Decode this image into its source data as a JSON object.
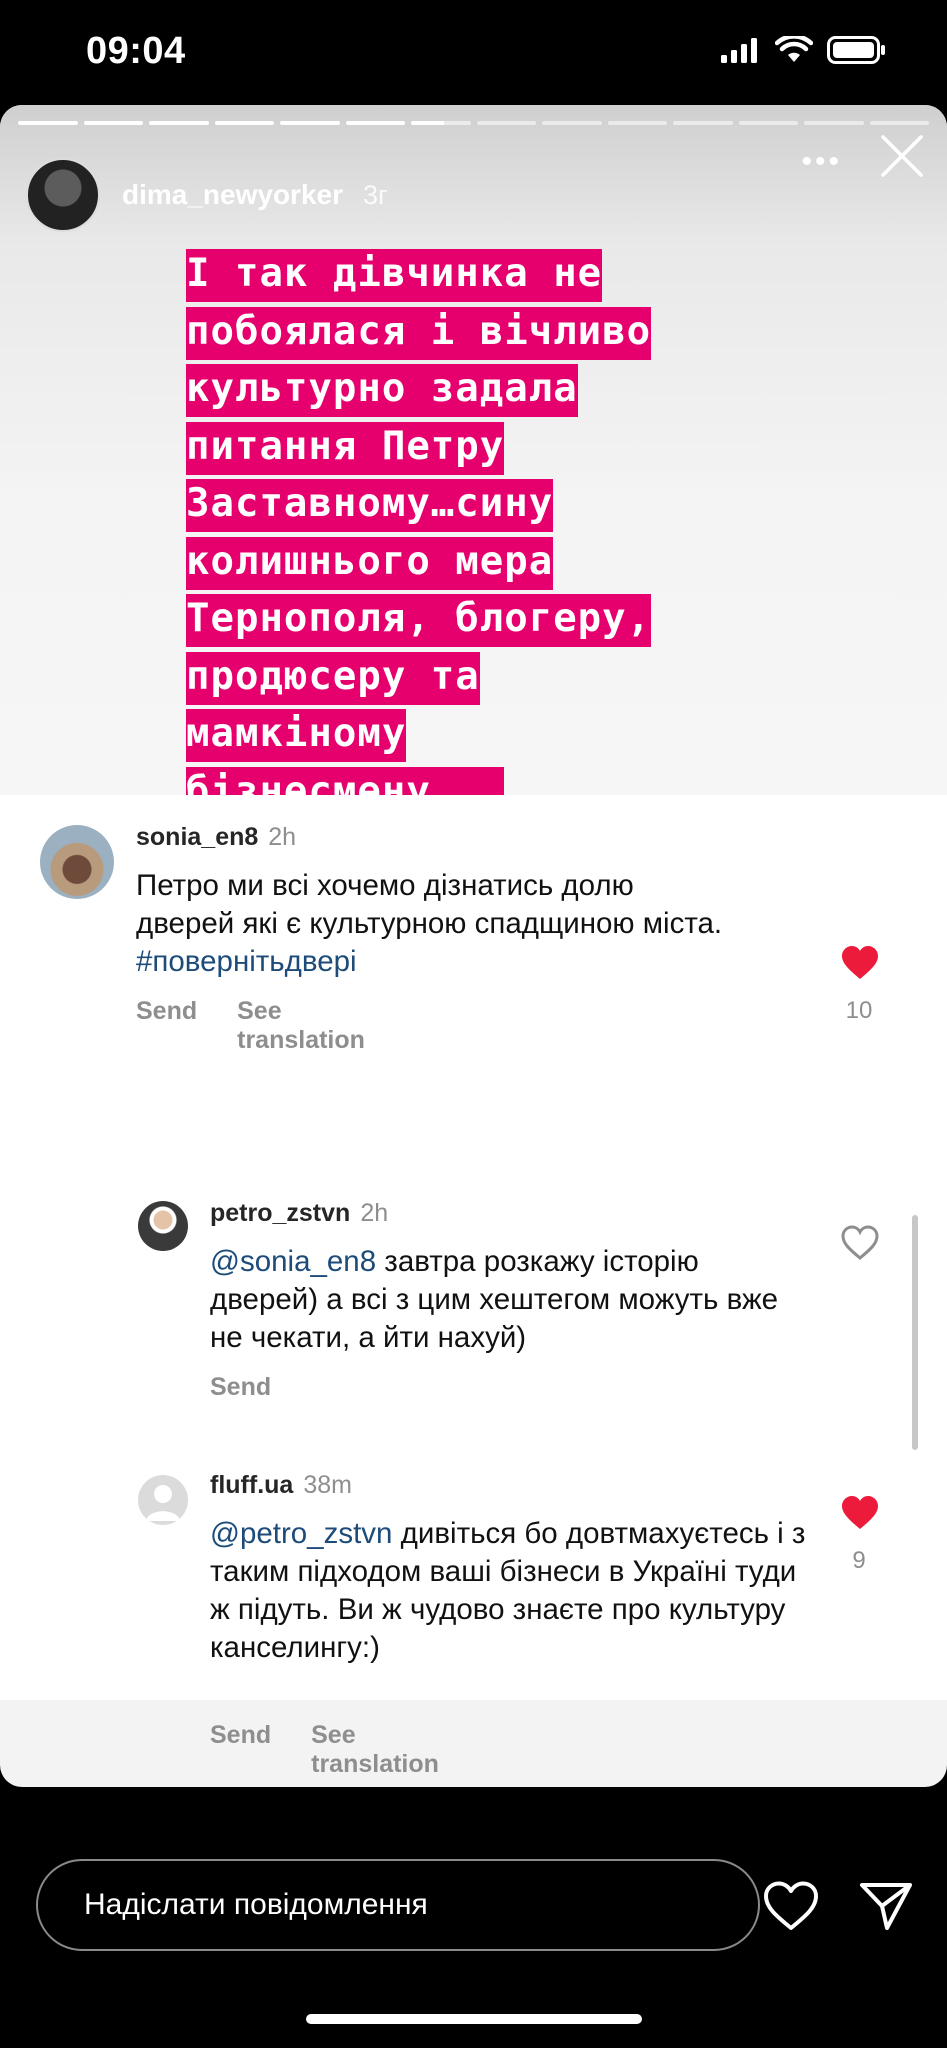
{
  "status_bar": {
    "time": "09:04"
  },
  "story": {
    "username": "dima_newyorker",
    "age": "3г",
    "progress_segments": 14,
    "progress_done": 6,
    "highlight_color": "#e6006e",
    "text_lines": [
      "І так дівчинка не",
      "побоялася і вічливо",
      "культурно задала",
      "питання Петру",
      "Заставному…сину",
      "колишнього мера",
      "Тернополя, блогеру,",
      "продюсеру та",
      "мамкіному",
      "бізнесмену …."
    ]
  },
  "comments": [
    {
      "username": "sonia_en8",
      "age": "2h",
      "mention": "",
      "text": "Петро ми всі хочемо дізнатись долю дверей які є культурною спадщиною міста.",
      "hashtag": "#повернітьдвері",
      "actions": [
        "Send",
        "See translation"
      ],
      "liked": true,
      "like_count": "10"
    },
    {
      "username": "petro_zstvn",
      "age": "2h",
      "mention": "@sonia_en8",
      "text": " завтра розкажу історію дверей) а всі з цим хештегом можуть вже не чекати, а йти нахуй)",
      "actions": [
        "Send"
      ],
      "liked": false,
      "like_count": ""
    },
    {
      "username": "fluff.ua",
      "age": "38m",
      "mention": "@petro_zstvn",
      "text": " дивіться бо довтмахуєтесь і з таким підходом ваші бізнеси в Україні туди ж підуть. Ви ж чудово знаєте про культуру канселингу:)",
      "actions": [
        "Send",
        "See translation"
      ],
      "liked": true,
      "like_count": "9"
    }
  ],
  "bottom_bar": {
    "message_placeholder": "Надіслати повідомлення"
  }
}
